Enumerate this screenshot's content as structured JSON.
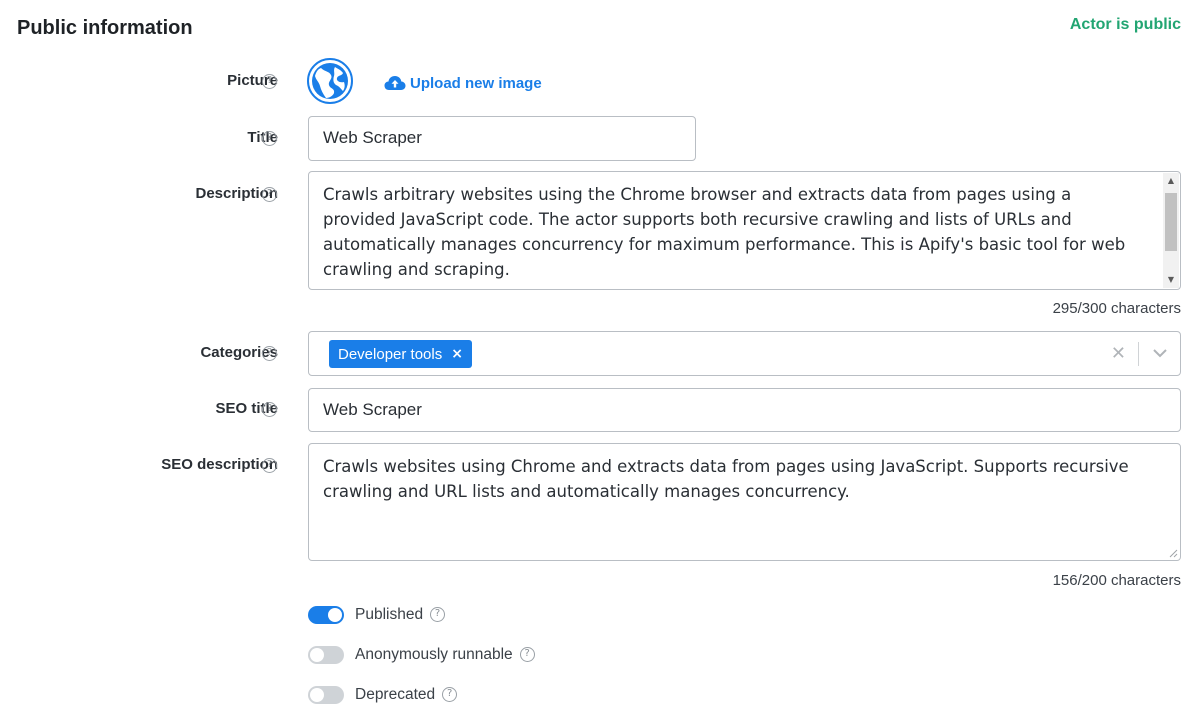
{
  "section": {
    "title": "Public information",
    "status": "Actor is public",
    "status_color": "#22a572"
  },
  "accent_color": "#1a7ee8",
  "picture": {
    "label": "Picture",
    "avatar_icon": "globe-icon",
    "upload_label": "Upload new image",
    "upload_icon": "cloud-upload-icon"
  },
  "title_field": {
    "label": "Title",
    "value": "Web Scraper"
  },
  "description": {
    "label": "Description",
    "value": "Crawls arbitrary websites using the Chrome browser and extracts data from pages using a provided JavaScript code. The actor supports both recursive crawling and lists of URLs and automatically manages concurrency for maximum performance. This is Apify's basic tool for web crawling and scraping.",
    "counter": "295/300 characters"
  },
  "categories": {
    "label": "Categories",
    "selected": [
      "Developer tools"
    ],
    "chip_remove": "×",
    "clear_icon": "close-icon",
    "dropdown_icon": "chevron-down-icon"
  },
  "seo_title": {
    "label": "SEO title",
    "value": "Web Scraper"
  },
  "seo_description": {
    "label": "SEO description",
    "value": "Crawls websites using Chrome and extracts data from pages using JavaScript. Supports recursive crawling and URL lists and automatically manages concurrency.",
    "counter": "156/200 characters"
  },
  "toggles": [
    {
      "label": "Published",
      "on": true
    },
    {
      "label": "Anonymously runnable",
      "on": false
    },
    {
      "label": "Deprecated",
      "on": false
    }
  ],
  "help_glyph": "?"
}
